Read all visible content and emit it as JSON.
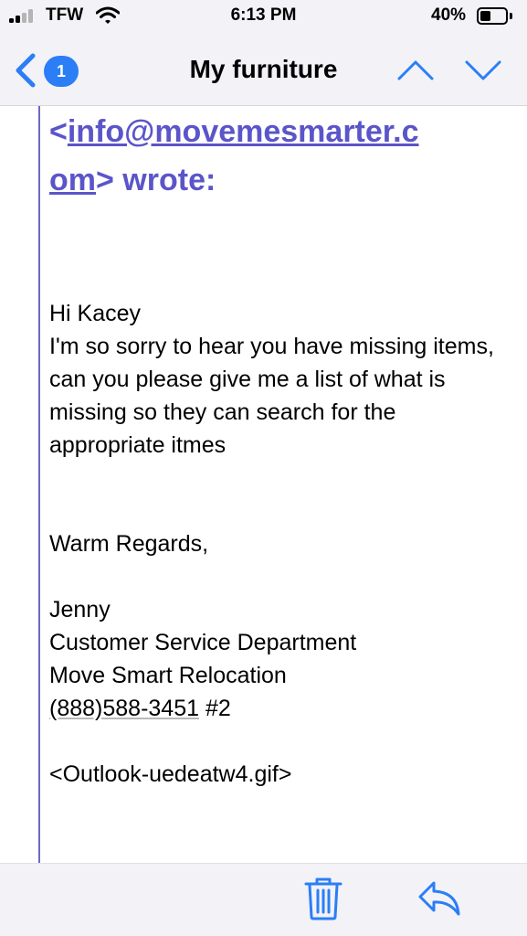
{
  "status_bar": {
    "carrier": "TFW",
    "time": "6:13 PM",
    "battery": "40%",
    "battery_level": 0.4,
    "signal_bars": 2
  },
  "nav": {
    "back_icon": "chevron-left-icon",
    "badge_count": "1",
    "title": "My furniture",
    "up_icon": "chevron-up-icon",
    "down_icon": "chevron-down-icon"
  },
  "message": {
    "from_prefix": "<",
    "from_email_part1": "info@movemesmarter.c",
    "from_email_part2": "om",
    "from_suffix": "> wrote:",
    "greeting": "Hi Kacey",
    "body": "I'm so sorry to hear you have missing items, can you please give me a list of what is missing so they can search for the appropriate itmes",
    "closing": "Warm Regards,",
    "sender_name": "Jenny",
    "department": "Customer Service Department",
    "company": "Move Smart Relocation",
    "phone": "(888)588-3451",
    "extension": " #2",
    "attachment": "<Outlook-uedeatw4.gif>"
  },
  "toolbar": {
    "trash_icon": "trash-icon",
    "reply_icon": "reply-icon"
  },
  "colors": {
    "accent": "#2b7ef6",
    "quote": "#5b55c9",
    "bar_bg": "#f2f2f7"
  }
}
